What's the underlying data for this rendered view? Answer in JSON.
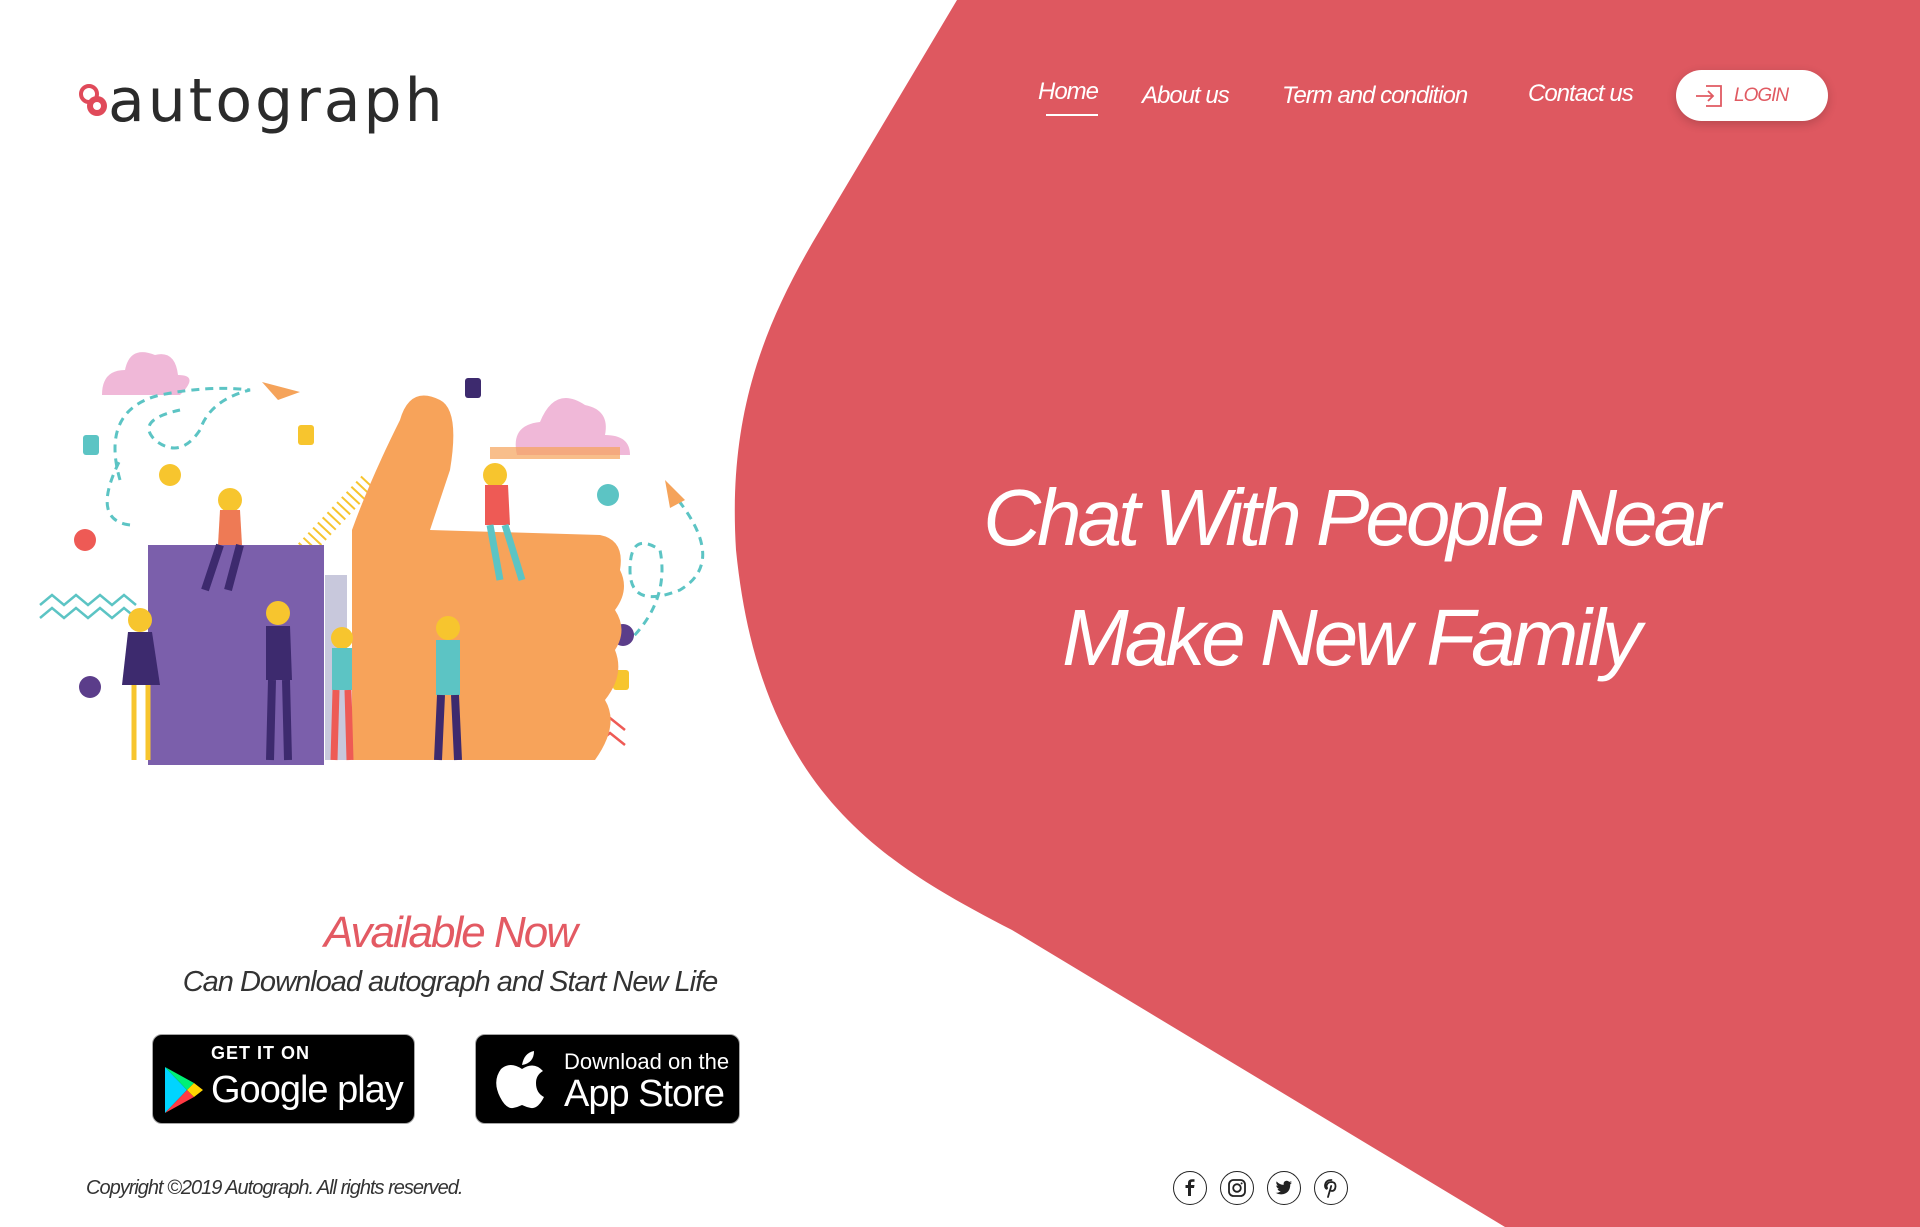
{
  "colors": {
    "accent": "#de5860",
    "dark": "#2b2b2b",
    "white": "#ffffff"
  },
  "logo": {
    "text": "autograph"
  },
  "nav": {
    "items": [
      {
        "label": "Home",
        "active": true
      },
      {
        "label": "About us",
        "active": false
      },
      {
        "label": "Term and condition",
        "active": false
      },
      {
        "label": "Contact us",
        "active": false
      }
    ],
    "login_label": "LOGIN"
  },
  "hero": {
    "line1": "Chat With People Near",
    "line2": "Make New Family"
  },
  "download": {
    "title": "Available Now",
    "subtitle": "Can Download autograph and Start New Life",
    "google": {
      "small": "GET IT ON",
      "big": "Google play"
    },
    "apple": {
      "small": "Download on the",
      "big": "App Store"
    }
  },
  "footer": {
    "copyright": "Copyright ©2019 Autograph. All rights reserved.",
    "social": [
      "facebook-icon",
      "instagram-icon",
      "twitter-icon",
      "pinterest-icon"
    ]
  }
}
